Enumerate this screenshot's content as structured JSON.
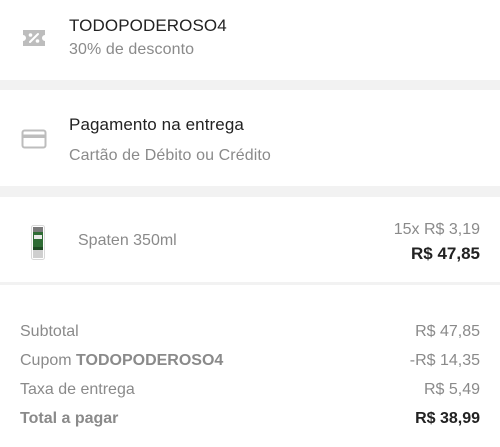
{
  "coupon": {
    "icon": "coupon-percent-icon",
    "code": "TODOPODEROSO4",
    "description": "30% de desconto"
  },
  "payment": {
    "icon": "credit-card-icon",
    "title": "Pagamento na entrega",
    "method": "Cartão de Débito ou Crédito"
  },
  "cart_item": {
    "name": "Spaten 350ml",
    "unit_price": "15x R$ 3,19",
    "total": "R$ 47,85"
  },
  "summary": {
    "subtotal_label": "Subtotal",
    "subtotal_value": "R$ 47,85",
    "coupon_label_prefix": "Cupom",
    "coupon_code": "TODOPODEROSO4",
    "coupon_value": "-R$ 14,35",
    "delivery_label": "Taxa de entrega",
    "delivery_value": "R$ 5,49",
    "total_label": "Total a pagar",
    "total_value": "R$ 38,99"
  },
  "colors": {
    "text_primary": "#222222",
    "text_secondary": "#8a8a8a",
    "icon_gray": "#bdbdbd",
    "separator": "#f2f2f2"
  }
}
